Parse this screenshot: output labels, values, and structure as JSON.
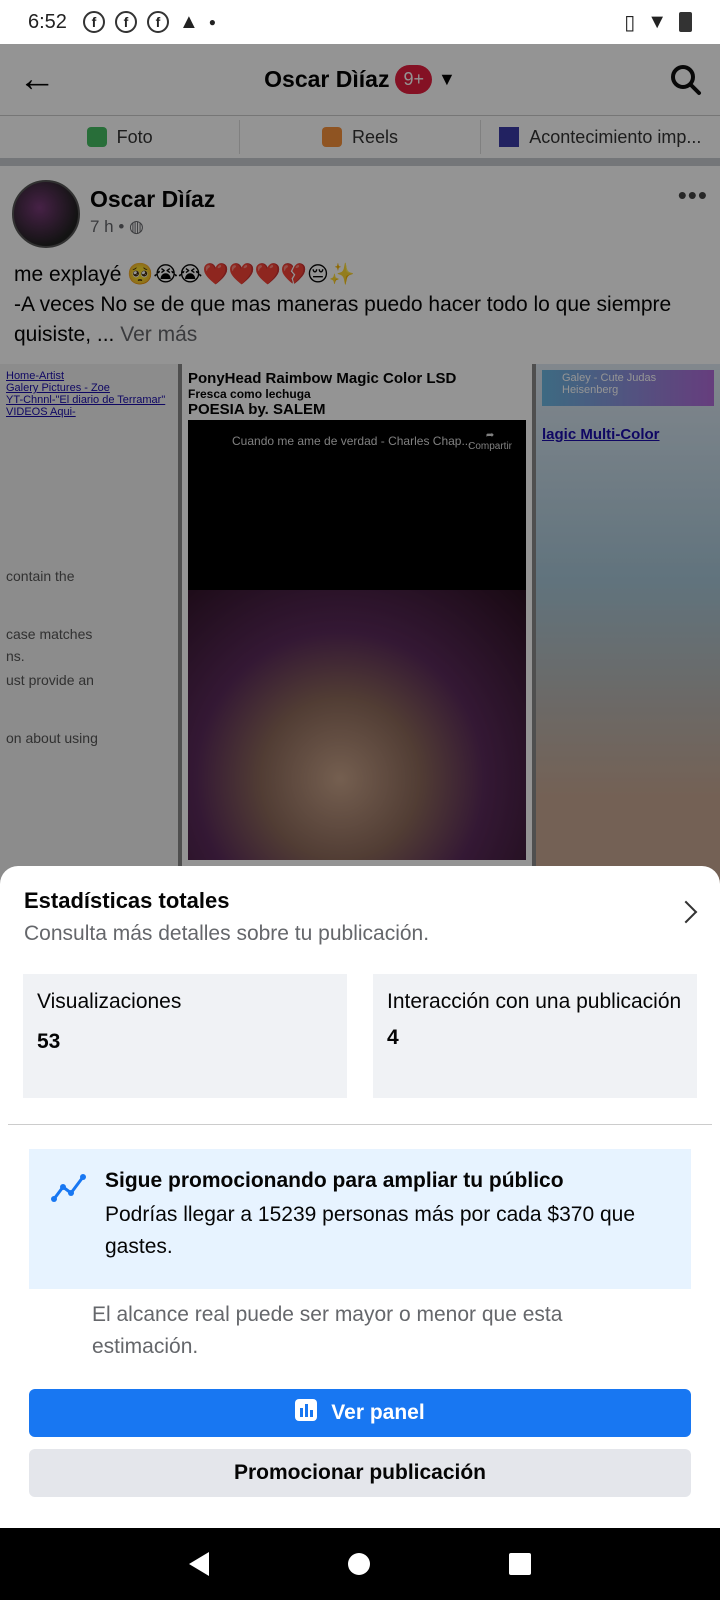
{
  "status_bar": {
    "time": "6:52",
    "icons": [
      "facebook-icon",
      "facebook-icon",
      "facebook-icon",
      "warning-icon",
      "dot-icon",
      "vibrate-icon",
      "wifi-icon",
      "battery-icon"
    ]
  },
  "header": {
    "title": "Oscar Dìíaz",
    "badge": "9+"
  },
  "composer": {
    "items": [
      "Foto",
      "Reels",
      "Acontecimiento imp..."
    ]
  },
  "post": {
    "author": "Oscar Dìíaz",
    "time": "7 h •",
    "text_line1": "me explayé 🥺😭😭❤️❤️❤️💔😔✨",
    "text_line2": "-A veces No se de que mas maneras puedo hacer todo lo que siempre quisiste, ... ",
    "see_more": "Ver más",
    "image": {
      "left_links": [
        "Home-Artist",
        "Galery Pictures - Zoe",
        "YT-Chnnl-\"El diario de Terramar\"",
        "VIDEOS Aqui-"
      ],
      "left_fragments": [
        "contain the",
        "case matches",
        "ns.",
        "ust provide an",
        "on about using"
      ],
      "mid_title": "PonyHead Raimbow Magic Color LSD",
      "mid_subtitle": "Fresca como lechuga",
      "mid_caption": "POESIA by. SALEM",
      "video_title": "Cuando me ame de verdad - Charles Chap...",
      "video_share": "Compartir",
      "right_top": "Galey - Cute Judas Heisenberg",
      "right_link": "lagic Multi-Color"
    }
  },
  "sheet": {
    "title": "Estadísticas totales",
    "subtitle": "Consulta más detalles sobre tu publicación.",
    "stats": [
      {
        "label": "Visualizaciones",
        "value": "53"
      },
      {
        "label": "Interacción con una publicación",
        "value": "4"
      }
    ],
    "promo_title": "Sigue promocionando para ampliar tu público",
    "promo_text": "Podrías llegar a 15239 personas más por cada $370 que gastes.",
    "note": "El alcance real puede ser mayor o menor que esta estimación.",
    "primary_button": "Ver panel",
    "secondary_button": "Promocionar publicación"
  },
  "colors": {
    "accent": "#1877f2",
    "promo_bg": "#e7f3ff",
    "badge": "#e41e3f"
  }
}
